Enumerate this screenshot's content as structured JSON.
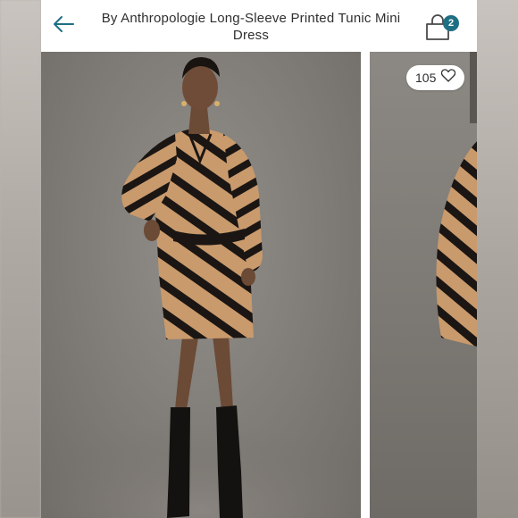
{
  "header": {
    "title": "By Anthropologie Long-Sleeve Printed Tunic Mini Dress",
    "back_icon": "arrow-left-icon",
    "bag_icon": "shopping-bag-icon",
    "bag_count": "2"
  },
  "carousel": {
    "likes": "105",
    "like_icon": "heart-icon"
  },
  "colors": {
    "accent": "#1f6f84",
    "dress_tan": "#c79a6e",
    "dress_black": "#1b1613",
    "backdrop": "#7f7b76"
  }
}
